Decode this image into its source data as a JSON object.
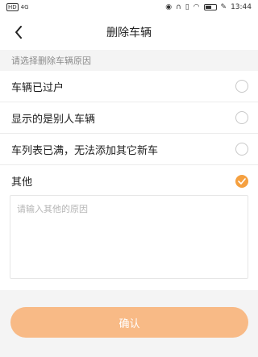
{
  "status_bar": {
    "left_badges": [
      "HD",
      "4G"
    ],
    "time": "13:44"
  },
  "header": {
    "back_icon": "chevron-left-icon",
    "title": "删除车辆"
  },
  "form": {
    "section_hint": "请选择删除车辆原因",
    "options": [
      {
        "label": "车辆已过户",
        "selected": false
      },
      {
        "label": "显示的是别人车辆",
        "selected": false
      },
      {
        "label": "车列表已满，无法添加其它新车",
        "selected": false
      },
      {
        "label": "其他",
        "selected": true
      }
    ],
    "other_reason": {
      "value": "",
      "placeholder": "请输入其他的原因"
    },
    "confirm_label": "确认"
  },
  "colors": {
    "accent": "#f5a040",
    "confirm_disabled": "#f8ba86",
    "page_bg": "#f4f4f4"
  }
}
